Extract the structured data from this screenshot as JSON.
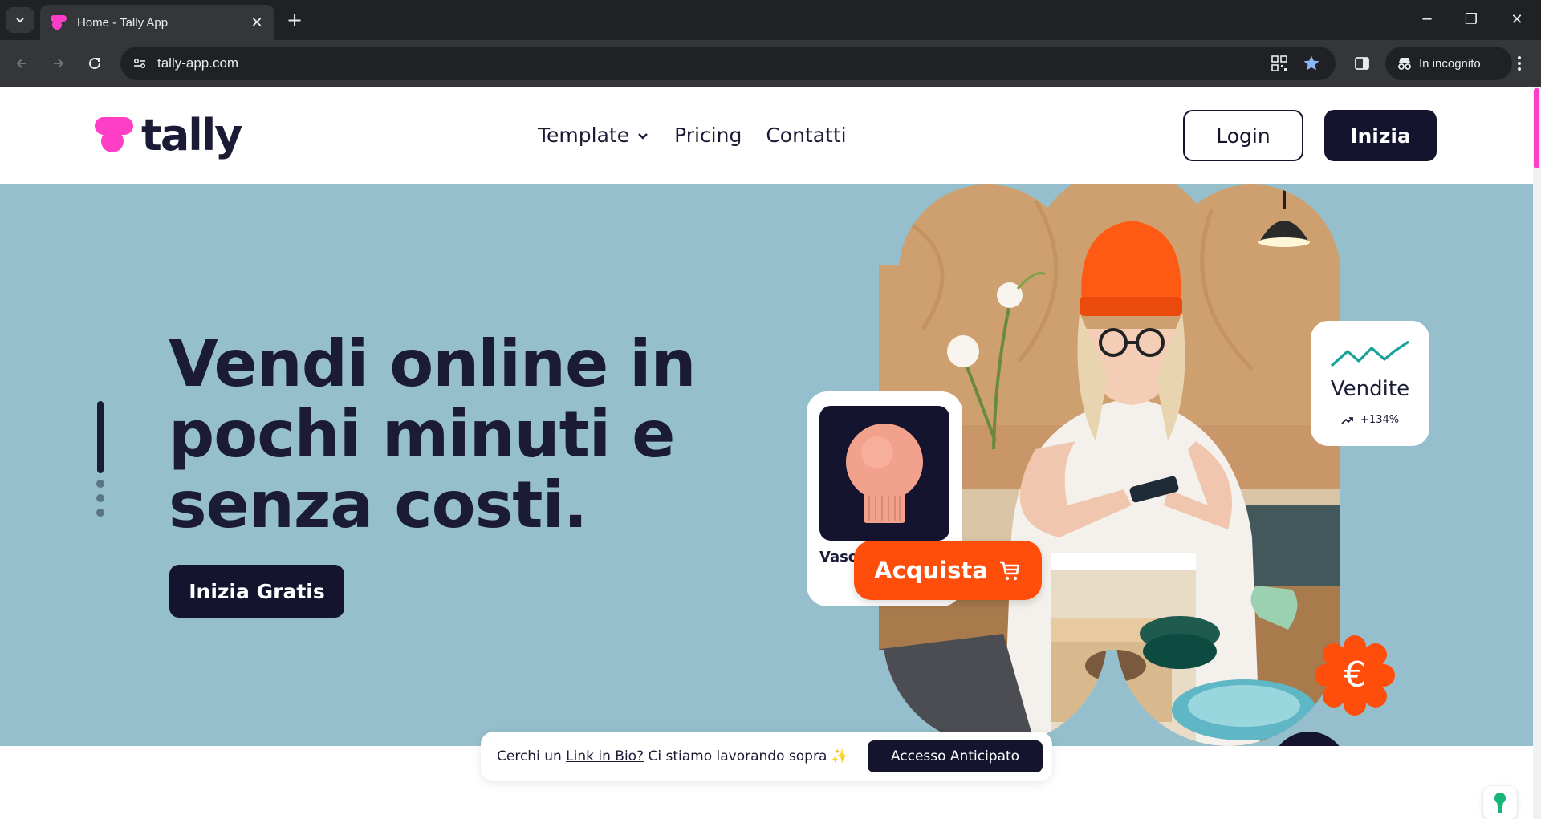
{
  "browser": {
    "tab_title": "Home - Tally App",
    "tab_close": "✕",
    "new_tab": "+",
    "url": "tally-app.com",
    "incognito_label": "In incognito",
    "window_controls": {
      "minimize": "─",
      "restore": "❐",
      "close": "✕"
    },
    "icons": [
      "tab-search-icon",
      "back-icon",
      "forward-icon",
      "reload-icon",
      "site-info-icon",
      "qr-code-icon",
      "bookmark-star-icon",
      "side-panel-icon",
      "incognito-icon",
      "kebab-menu-icon"
    ]
  },
  "header": {
    "logo_text": "tally",
    "nav": [
      {
        "label": "Template",
        "has_dropdown": true
      },
      {
        "label": "Pricing"
      },
      {
        "label": "Contatti"
      }
    ],
    "login_label": "Login",
    "start_label": "Inizia"
  },
  "hero": {
    "headline": "Vendi online in pochi minuti e senza costi.",
    "cta_label": "Inizia Gratis",
    "product_card_label": "Vaso Artigianale",
    "buy_label": "Acquista",
    "sales_card": {
      "label": "Vendite",
      "delta": "+134%"
    },
    "euro_symbol": "€",
    "dollar_symbol": "$"
  },
  "banner": {
    "text_before": "Cerchi un ",
    "link_text": "Link in Bio?",
    "text_after": " Ci stiamo lavorando sopra ✨",
    "button_label": "Accesso Anticipato"
  },
  "colors": {
    "brand_pink": "#ff3ec7",
    "navy": "#14142e",
    "hero_bg": "#96bfcd",
    "orange": "#ff4d0b",
    "teal": "#1aa39a"
  }
}
